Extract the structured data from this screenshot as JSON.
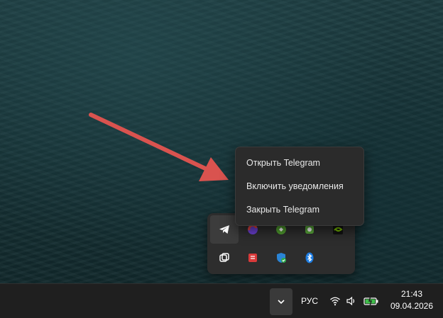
{
  "context_menu": {
    "items": [
      {
        "label": "Открыть Telegram",
        "icon": null
      },
      {
        "label": "Включить уведомления",
        "icon": null
      },
      {
        "label": "Закрыть Telegram",
        "icon": null
      }
    ]
  },
  "tray_overflow": {
    "icons": [
      "telegram-icon",
      "yandex-browser-icon",
      "green-app-icon",
      "green-shield-app-icon",
      "nvidia-icon",
      "copy-app-icon",
      "red-book-app-icon",
      "windows-security-icon",
      "bluetooth-icon"
    ]
  },
  "taskbar": {
    "language": "РУС",
    "time": "21:43",
    "date": "09.04.2026",
    "system_icons": [
      "wifi-icon",
      "volume-icon",
      "battery-charging-icon"
    ]
  },
  "colors": {
    "arrow": "#d9534f",
    "menu_bg": "#2b2b2b",
    "taskbar_bg": "#1f1f1f"
  }
}
